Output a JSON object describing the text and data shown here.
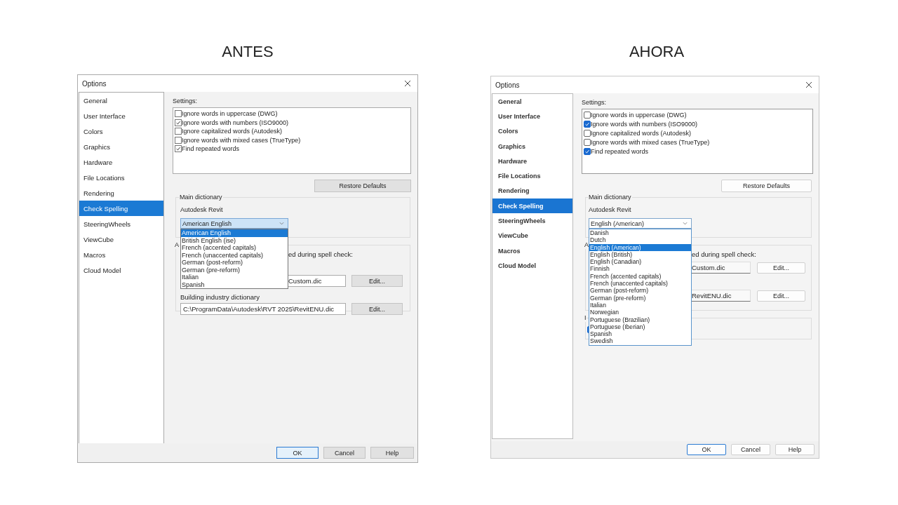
{
  "comparison": [
    {
      "heading": "ANTES",
      "dialog": {
        "kind": "classic",
        "title": "Options",
        "sidebar": {
          "items": [
            {
              "label": "General",
              "selected": false
            },
            {
              "label": "User Interface",
              "selected": false
            },
            {
              "label": "Colors",
              "selected": false
            },
            {
              "label": "Graphics",
              "selected": false
            },
            {
              "label": "Hardware",
              "selected": false
            },
            {
              "label": "File Locations",
              "selected": false
            },
            {
              "label": "Rendering",
              "selected": false
            },
            {
              "label": "Check Spelling",
              "selected": true
            },
            {
              "label": "SteeringWheels",
              "selected": false
            },
            {
              "label": "ViewCube",
              "selected": false
            },
            {
              "label": "Macros",
              "selected": false
            },
            {
              "label": "Cloud Model",
              "selected": false
            }
          ]
        },
        "settings": {
          "label": "Settings:",
          "items": [
            {
              "label": "Ignore words in uppercase (DWG)",
              "checked": false
            },
            {
              "label": "Ignore words with numbers (ISO9000)",
              "checked": true
            },
            {
              "label": "Ignore capitalized words (Autodesk)",
              "checked": false
            },
            {
              "label": "Ignore words with mixed cases (TrueType)",
              "checked": false
            },
            {
              "label": "Find repeated words",
              "checked": true
            }
          ]
        },
        "restore_button": "Restore Defaults",
        "main_dictionary": {
          "legend": "Main dictionary",
          "label": "Autodesk Revit",
          "value": "American English",
          "options": [
            {
              "label": "American English",
              "selected": true
            },
            {
              "label": "British English (ise)",
              "selected": false
            },
            {
              "label": "French (accented capitals)",
              "selected": false
            },
            {
              "label": "French (unaccented capitals)",
              "selected": false
            },
            {
              "label": "German (post-reform)",
              "selected": false
            },
            {
              "label": "German (pre-reform)",
              "selected": false
            },
            {
              "label": "Italian",
              "selected": false
            },
            {
              "label": "Spanish",
              "selected": false
            }
          ]
        },
        "additional": {
          "legend": "A",
          "note": "ed during spell check:",
          "rows": [
            {
              "value": "Custom.dic",
              "clipped": true,
              "button": "Edit..."
            },
            {
              "label": "Building industry dictionary",
              "value": "C:\\ProgramData\\Autodesk\\RVT 2025\\RevitENU.dic",
              "clipped": false,
              "button": "Edit..."
            }
          ]
        },
        "buttons": [
          {
            "label": "OK",
            "default": true
          },
          {
            "label": "Cancel",
            "default": false
          },
          {
            "label": "Help",
            "default": false
          }
        ]
      }
    },
    {
      "heading": "AHORA",
      "dialog": {
        "kind": "modern",
        "title": "Options",
        "sidebar": {
          "items": [
            {
              "label": "General",
              "selected": false
            },
            {
              "label": "User Interface",
              "selected": false
            },
            {
              "label": "Colors",
              "selected": false
            },
            {
              "label": "Graphics",
              "selected": false
            },
            {
              "label": "Hardware",
              "selected": false
            },
            {
              "label": "File Locations",
              "selected": false
            },
            {
              "label": "Rendering",
              "selected": false
            },
            {
              "label": "Check Spelling",
              "selected": true
            },
            {
              "label": "SteeringWheels",
              "selected": false
            },
            {
              "label": "ViewCube",
              "selected": false
            },
            {
              "label": "Macros",
              "selected": false
            },
            {
              "label": "Cloud Model",
              "selected": false
            }
          ]
        },
        "settings": {
          "label": "Settings:",
          "items": [
            {
              "label": "Ignore words in uppercase (DWG)",
              "checked": false
            },
            {
              "label": "Ignore words with numbers (ISO9000)",
              "checked": true
            },
            {
              "label": "Ignore capitalized words (Autodesk)",
              "checked": false
            },
            {
              "label": "Ignore words with mixed cases (TrueType)",
              "checked": false
            },
            {
              "label": "Find repeated words",
              "checked": true
            }
          ]
        },
        "restore_button": "Restore Defaults",
        "main_dictionary": {
          "legend": "Main dictionary",
          "label": "Autodesk Revit",
          "value": "English (American)",
          "options": [
            {
              "label": "Danish",
              "selected": false
            },
            {
              "label": "Dutch",
              "selected": false
            },
            {
              "label": "English (American)",
              "selected": true
            },
            {
              "label": "English (British)",
              "selected": false
            },
            {
              "label": "English (Canadian)",
              "selected": false
            },
            {
              "label": "Finnish",
              "selected": false
            },
            {
              "label": "French (accented capitals)",
              "selected": false
            },
            {
              "label": "French (unaccented capitals)",
              "selected": false
            },
            {
              "label": "German (post-reform)",
              "selected": false
            },
            {
              "label": "German (pre-reform)",
              "selected": false
            },
            {
              "label": "Italian",
              "selected": false
            },
            {
              "label": "Norwegian",
              "selected": false
            },
            {
              "label": "Portuguese (Brazilian)",
              "selected": false
            },
            {
              "label": "Portuguese (Iberian)",
              "selected": false
            },
            {
              "label": "Spanish",
              "selected": false
            },
            {
              "label": "Swedish",
              "selected": false
            }
          ]
        },
        "additional": {
          "legend": "A",
          "note": "ed during spell check:",
          "rows": [
            {
              "value": "Custom.dic",
              "clipped": true,
              "button": "Edit..."
            },
            {
              "value": "RevitENU.dic",
              "clipped": true,
              "button": "Edit..."
            }
          ]
        },
        "extra_group": {
          "legend": "I",
          "checked": true
        },
        "buttons": [
          {
            "label": "OK",
            "default": true
          },
          {
            "label": "Cancel",
            "default": false
          },
          {
            "label": "Help",
            "default": false
          }
        ]
      }
    }
  ]
}
